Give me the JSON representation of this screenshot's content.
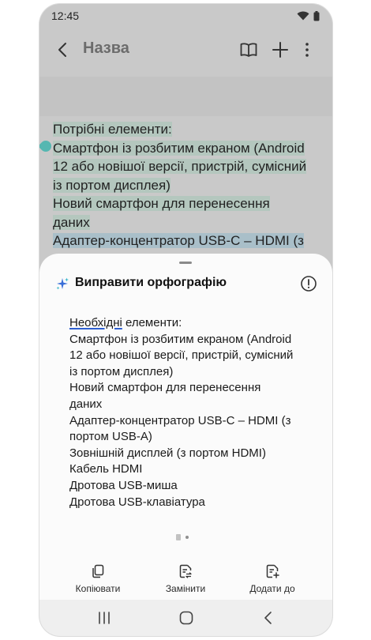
{
  "status": {
    "time": "12:45"
  },
  "appbar": {
    "title": "Назва"
  },
  "note": {
    "lines": [
      "Потрібні елементи:",
      "Смартфон із розбитим екраном (Android",
      "12 або новішої версії, пристрій, сумісний",
      "із портом дисплея)",
      "Новий смартфон для перенесення",
      "даних",
      "Адаптер-концентратор USB-C – HDMI (з"
    ]
  },
  "sheet": {
    "title": "Виправити орфографію",
    "corrected_word": "Необхідні",
    "first_line_rest": " елементи:",
    "lines": [
      "Смартфон із розбитим екраном (Android",
      "12 або новішої версії, пристрій, сумісний",
      "із портом дисплея)",
      "Новий смартфон для перенесення",
      "даних",
      "Адаптер-концентратор USB-C – HDMI (з",
      "портом USB-A)",
      "Зовнішній дисплей (з портом HDMI)",
      "Кабель HDMI",
      "Дротова USB-миша",
      "Дротова USB-клавіатура"
    ],
    "actions": {
      "copy": "Копіювати",
      "replace": "Замінити",
      "add_to": "Додати до"
    }
  },
  "colors": {
    "accent_underline": "#2d5fd1",
    "highlight": "#b4c7be",
    "cursor": "#55b7b1"
  },
  "icons": [
    "back-icon",
    "book-icon",
    "plus-icon",
    "more-icon",
    "sparkle-icon",
    "info-icon",
    "copy-icon",
    "replace-icon",
    "add-to-icon",
    "recents-icon",
    "home-icon",
    "nav-back-icon"
  ]
}
